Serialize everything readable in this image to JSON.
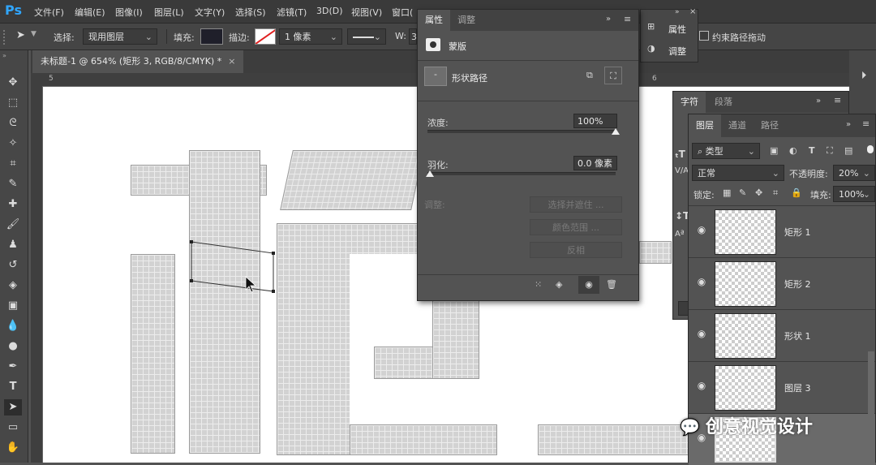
{
  "menubar": {
    "logo": "Ps",
    "items": [
      "文件(F)",
      "编辑(E)",
      "图像(I)",
      "图层(L)",
      "文字(Y)",
      "选择(S)",
      "滤镜(T)",
      "3D(D)",
      "视图(V)",
      "窗口("
    ]
  },
  "options": {
    "select_label": "选择:",
    "select_value": "现用图层",
    "fill_label": "填充:",
    "stroke_label": "描边:",
    "stroke_width": "1 像素",
    "w_label": "W:",
    "w_value": "3",
    "constrain_label": "约束路径拖动"
  },
  "document": {
    "tab_title": "未标题-1 @ 654% (矩形 3, RGB/8/CMYK) *",
    "ruler_marks": [
      "5",
      "6"
    ]
  },
  "properties_panel": {
    "tabs": [
      "属性",
      "调整"
    ],
    "mask_label": "蒙版",
    "path_label": "形状路径",
    "density_label": "浓度:",
    "density_value": "100%",
    "density_level": 1.0,
    "feather_label": "羽化:",
    "feather_value": "0.0 像素",
    "feather_level": 0.0,
    "adjust_label": "调整:",
    "btn_select_mask": "选择并遮住 ...",
    "btn_color_range": "颜色范围 ...",
    "btn_invert": "反相"
  },
  "mini_panel": {
    "items": [
      "属性",
      "调整"
    ]
  },
  "char_panel": {
    "tabs": [
      "字符",
      "段落"
    ]
  },
  "layers_panel": {
    "tabs": [
      "图层",
      "通道",
      "路径"
    ],
    "filter_type": "类型",
    "blend_mode": "正常",
    "opacity_label": "不透明度:",
    "opacity_value": "20%",
    "lock_label": "锁定:",
    "fill_label": "填充:",
    "fill_value": "100%",
    "layers": [
      {
        "name": "矩形 1"
      },
      {
        "name": "矩形 2"
      },
      {
        "name": "形状 1"
      },
      {
        "name": "图层 3"
      },
      {
        "name": ""
      }
    ]
  },
  "watermark": "创意视觉设计",
  "colors": {
    "accent": "#30a6ff",
    "panel_bg": "#535353",
    "canvas_bg": "#ffffff"
  }
}
